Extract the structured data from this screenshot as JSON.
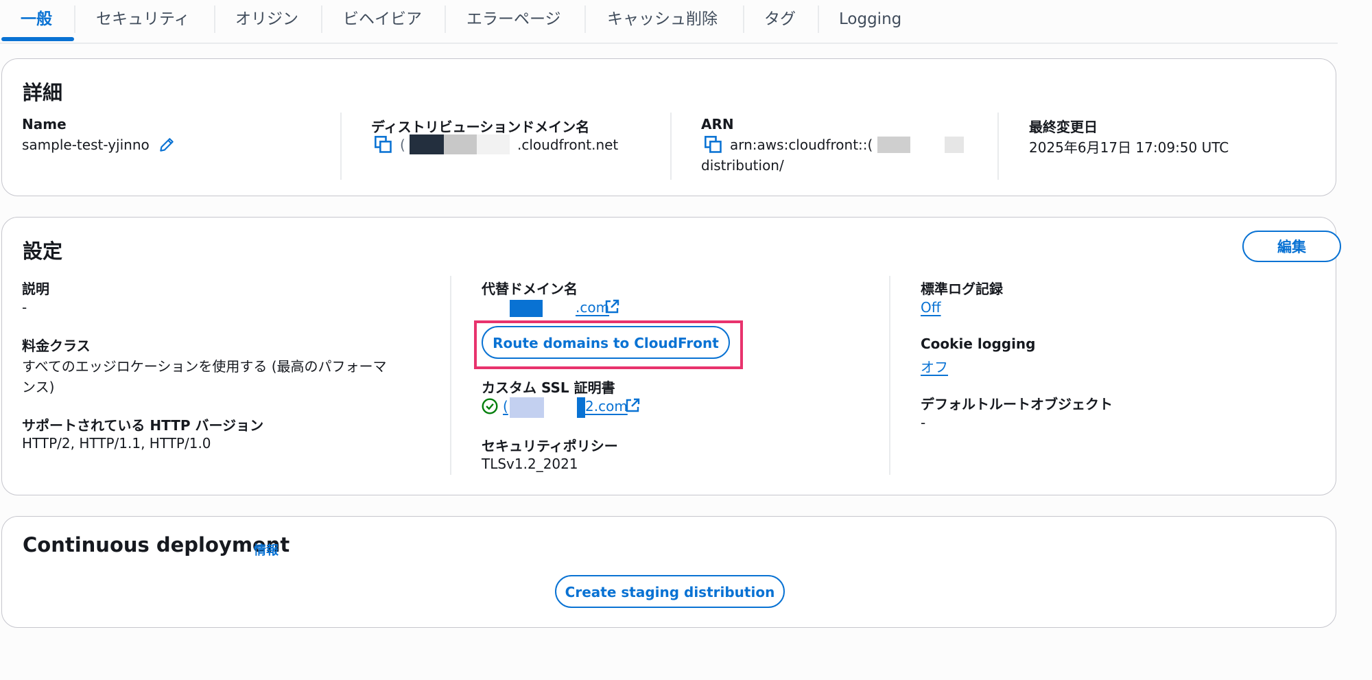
{
  "tabs": [
    {
      "label": "一般"
    },
    {
      "label": "セキュリティ"
    },
    {
      "label": "オリジン"
    },
    {
      "label": "ビヘイビア"
    },
    {
      "label": "エラーページ"
    },
    {
      "label": "キャッシュ削除"
    },
    {
      "label": "タグ"
    },
    {
      "label": "Logging"
    }
  ],
  "details": {
    "title": "詳細",
    "name_label": "Name",
    "name_value": "sample-test-yjinno",
    "domain_label": "ディストリビューションドメイン名",
    "domain_prefix": "(",
    "domain_suffix": ".cloudfront.net",
    "arn_label": "ARN",
    "arn_line1": "arn:aws:cloudfront::(",
    "arn_line2": "distribution/",
    "modified_label": "最終変更日",
    "modified_value": "2025年6月17日 17:09:50 UTC"
  },
  "settings": {
    "title": "設定",
    "edit_button": "編集",
    "description_label": "説明",
    "description_value": "-",
    "price_class_label": "料金クラス",
    "price_class_line1": "すべてのエッジロケーションを使用する (最高のパフォーマ",
    "price_class_line2": "ンス)",
    "http_label": "サポートされている HTTP バージョン",
    "http_value": "HTTP/2, HTTP/1.1, HTTP/1.0",
    "alt_domain_label": "代替ドメイン名",
    "alt_domain_suffix": ".com",
    "route_button": "Route domains to CloudFront",
    "ssl_label": "カスタム SSL 証明書",
    "ssl_prefix": "(",
    "ssl_suffix": "2.com",
    "policy_label": "セキュリティポリシー",
    "policy_value": "TLSv1.2_2021",
    "std_log_label": "標準ログ記録",
    "std_log_value": "Off",
    "cookie_label": "Cookie logging",
    "cookie_value": "オフ",
    "root_label": "デフォルトルートオブジェクト",
    "root_value": "-"
  },
  "continuous": {
    "title": "Continuous deployment",
    "info_link": "情報",
    "create_button": "Create staging distribution"
  },
  "colors": {
    "accent": "#0972d3",
    "highlight": "#e8336d",
    "success": "#037f0c"
  }
}
